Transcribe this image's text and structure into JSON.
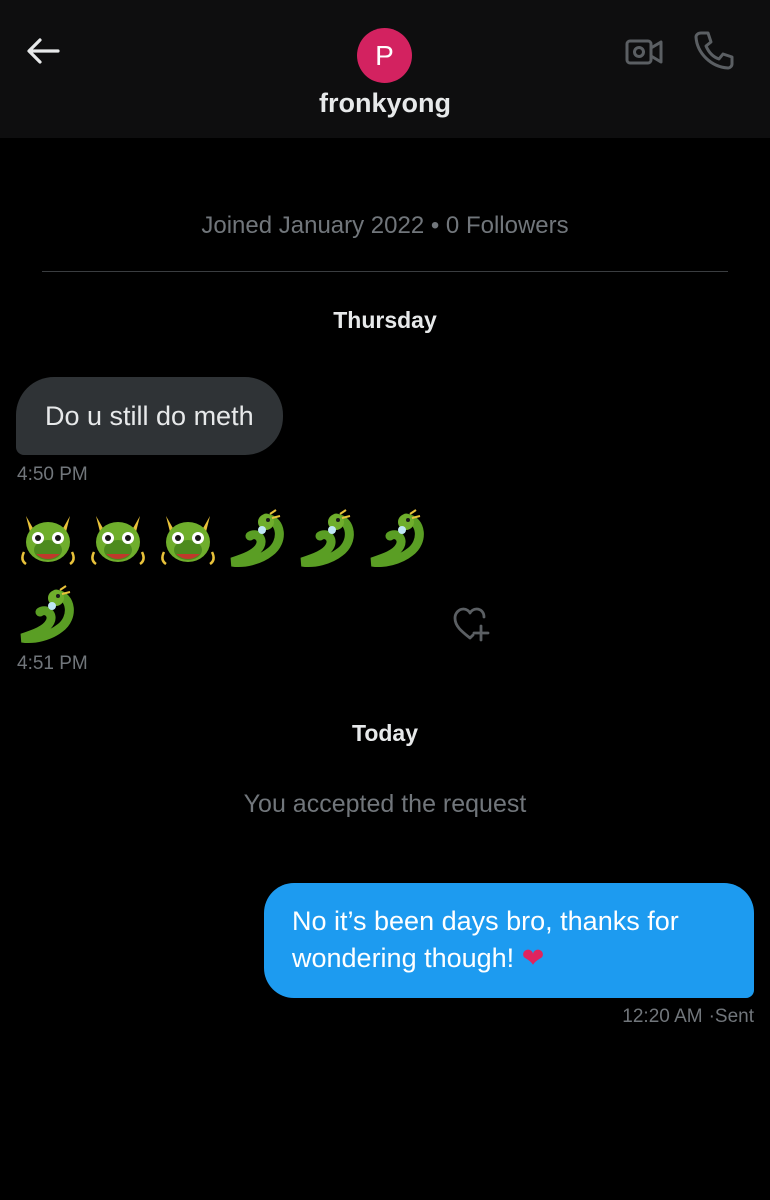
{
  "header": {
    "back_label": "back",
    "avatar_letter": "P",
    "avatar_color": "#d32260",
    "username": "fronkyong"
  },
  "profile": {
    "join_info": "Joined January 2022 • 0 Followers"
  },
  "days": {
    "first": "Thursday",
    "second": "Today"
  },
  "messages": {
    "incoming_text": "Do u still do meth",
    "incoming_time": "4:50 PM",
    "emoji_time": "4:51 PM",
    "emoji_icons": [
      "dragon-face-icon",
      "dragon-face-icon",
      "dragon-face-icon",
      "dragon-icon",
      "dragon-icon",
      "dragon-icon",
      "dragon-icon"
    ],
    "system_text": "You accepted the request",
    "outgoing_line1": "No it’s been days bro, thanks for",
    "outgoing_line2": "wondering though!",
    "outgoing_heart": "❤",
    "outgoing_time": "12:20 AM",
    "outgoing_status": "·Sent"
  },
  "colors": {
    "background": "#000000",
    "header_bg": "#0e0e0f",
    "incoming_bubble": "#2f3336",
    "outgoing_bubble": "#1d9bf0",
    "muted_text": "#71767b"
  }
}
